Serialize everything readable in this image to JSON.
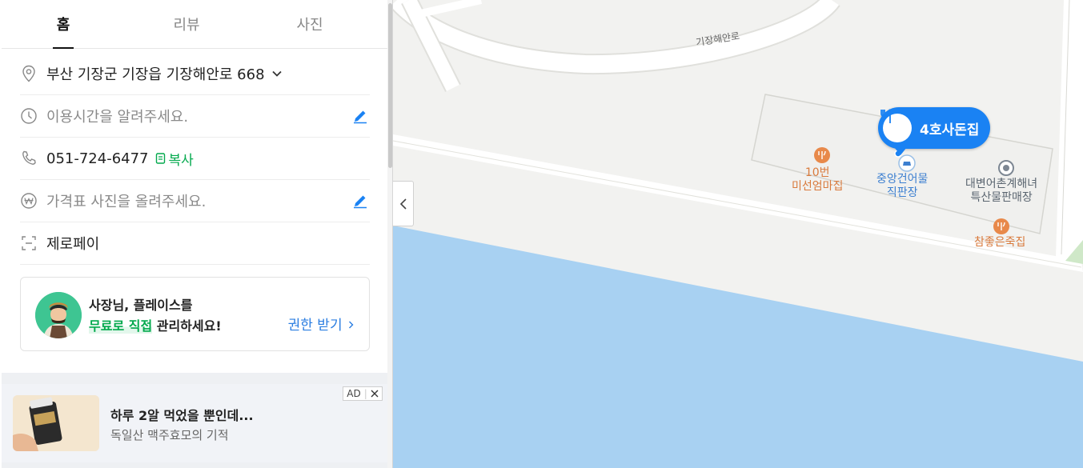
{
  "tabs": [
    {
      "label": "홈"
    },
    {
      "label": "리뷰"
    },
    {
      "label": "사진"
    }
  ],
  "info": {
    "address": "부산 기장군 기장읍 기장해안로 668",
    "hours_placeholder": "이용시간을 알려주세요.",
    "phone": "051-724-6477",
    "copy_label": "복사",
    "price_placeholder": "가격표 사진을 올려주세요.",
    "payment": "제로페이"
  },
  "owner_card": {
    "line1": "사장님, 플레이스를",
    "highlight": "무료로 직접",
    "line2_rest": " 관리하세요!",
    "link_label": "권한 받기"
  },
  "ad": {
    "badge": "AD",
    "title": "하루 2알 먹었을 뿐인데...",
    "subtitle": "독일산 맥주효모의 기적"
  },
  "map": {
    "road_label": "기장해안로",
    "selected_place": "4호사돈집",
    "pois": [
      {
        "name": "10번\n미선엄마집",
        "kind": "restaurant"
      },
      {
        "name": "중앙건어물\n직판장",
        "kind": "shop"
      },
      {
        "name": "대변어촌계해녀\n특산물판매장",
        "kind": "place"
      },
      {
        "name": "참좋은죽집",
        "kind": "restaurant"
      }
    ],
    "colors": {
      "land": "#f2f2f0",
      "sea": "#a8d1f2",
      "road": "#ffffff",
      "marker": "#1a82f3",
      "poi_restaurant": "#e8894a"
    }
  },
  "accent": {
    "green": "#03a94d",
    "blue": "#2a7de1"
  }
}
